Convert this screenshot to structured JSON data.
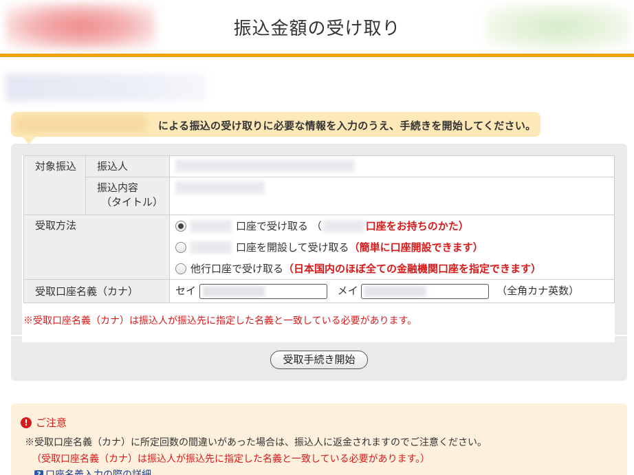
{
  "header": {
    "title": "振込金額の受け取り"
  },
  "banner": {
    "text": "による振込の受け取りに必要な情報を入力のうえ、手続きを開始してください。"
  },
  "table": {
    "target_label": "対象振込",
    "payer_label": "振込人",
    "content_label": "振込内容",
    "content_sublabel": "（タイトル）",
    "method_label": "受取方法",
    "options": [
      {
        "text": "口座で受け取る （",
        "note": "口座をお持ちのかた）"
      },
      {
        "text": "口座を開設して受け取る ",
        "note": "（簡単に口座開設できます）"
      },
      {
        "text": "他行口座で受け取る ",
        "note": "（日本国内のほぼ全ての金融機関口座を指定できます）"
      }
    ],
    "name_label": "受取口座名義（カナ）",
    "sei_label": "セイ",
    "mei_label": "メイ",
    "name_hint": "（全角カナ英数）"
  },
  "warning": "※受取口座名義（カナ）は振込人が振込先に指定した名義と一致している必要があります。",
  "submit_label": "受取手続き開始",
  "caution": {
    "title": "ご注意",
    "line1": "※受取口座名義（カナ）に所定回数の間違いがあった場合は、振込人に返金されますのでご注意ください。",
    "line2": "（受取口座名義（カナ）は振込人が振込先に指定した名義と一致している必要があります。）",
    "link": "口座名義入力の際の詳細"
  },
  "colors": {
    "accent": "#f0a30a",
    "warning": "#d61a1a",
    "banner": "#fde8b8",
    "caution_bg": "#fdf0dc"
  },
  "icons": {
    "alert": "alert-icon",
    "help": "help-icon"
  }
}
